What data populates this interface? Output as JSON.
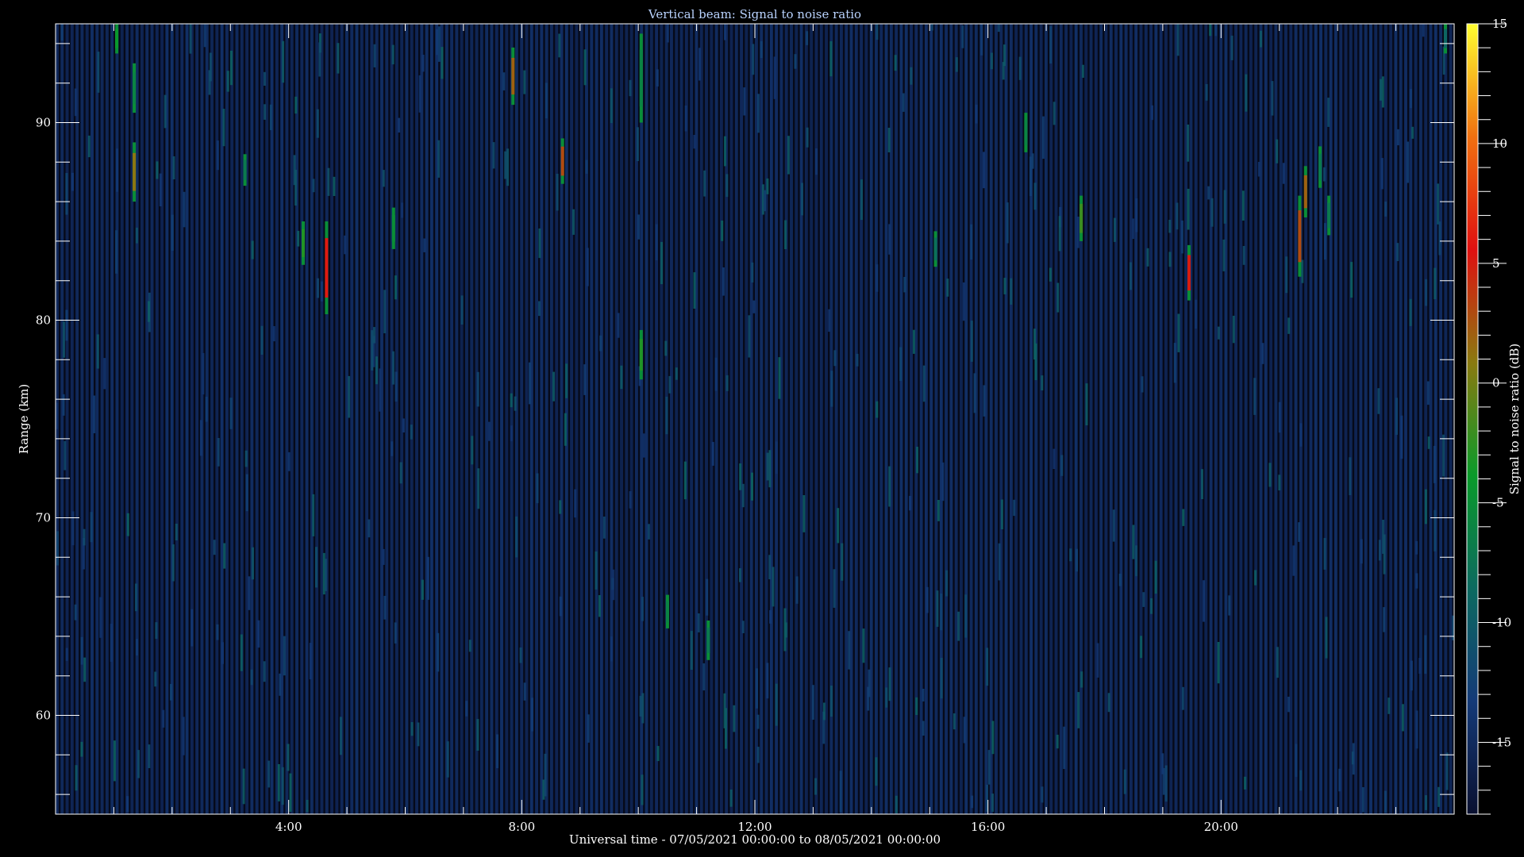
{
  "chart_data": {
    "type": "heatmap",
    "title": "Vertical beam: Signal to noise ratio",
    "xlabel": "Universal time - 07/05/2021 00:00:00 to 08/05/2021 00:00:00",
    "ylabel": "Range (km)",
    "colorbar_label": "Signal to noise ratio (dB)",
    "xlim_hours": [
      0,
      24
    ],
    "ylim_km": [
      55,
      95
    ],
    "zlim_db": [
      -18,
      15
    ],
    "x_ticks": [
      {
        "value": 4,
        "label": "4:00"
      },
      {
        "value": 8,
        "label": "8:00"
      },
      {
        "value": 12,
        "label": "12:00"
      },
      {
        "value": 16,
        "label": "16:00"
      },
      {
        "value": 20,
        "label": "20:00"
      }
    ],
    "y_ticks": [
      {
        "value": 60,
        "label": "60"
      },
      {
        "value": 70,
        "label": "70"
      },
      {
        "value": 80,
        "label": "80"
      },
      {
        "value": 90,
        "label": "90"
      }
    ],
    "colorbar_ticks": [
      {
        "value": 15,
        "label": "15"
      },
      {
        "value": 10,
        "label": "10"
      },
      {
        "value": 5,
        "label": "5"
      },
      {
        "value": 0,
        "label": "0"
      },
      {
        "value": -5,
        "label": "-5"
      },
      {
        "value": -10,
        "label": "-10"
      },
      {
        "value": -15,
        "label": "-15"
      }
    ],
    "colormap": [
      "#0a1030",
      "#143a78",
      "#0c6a60",
      "#0a9a2a",
      "#8a7a10",
      "#e01010",
      "#f07010",
      "#ffff30"
    ],
    "background_db": -16,
    "echoes": [
      {
        "t": 1.05,
        "r0": 93.5,
        "r1": 95.0,
        "db": -4
      },
      {
        "t": 1.35,
        "r0": 90.5,
        "r1": 93.0,
        "db": -6
      },
      {
        "t": 1.35,
        "r0": 86.0,
        "r1": 89.0,
        "db": 1
      },
      {
        "t": 3.25,
        "r0": 86.8,
        "r1": 88.4,
        "db": -7
      },
      {
        "t": 4.25,
        "r0": 82.8,
        "r1": 85.0,
        "db": -3
      },
      {
        "t": 4.65,
        "r0": 80.3,
        "r1": 85.0,
        "db": 6
      },
      {
        "t": 5.8,
        "r0": 83.6,
        "r1": 85.7,
        "db": -5
      },
      {
        "t": 7.85,
        "r0": 90.9,
        "r1": 93.8,
        "db": 2
      },
      {
        "t": 8.7,
        "r0": 86.9,
        "r1": 89.2,
        "db": 3
      },
      {
        "t": 10.05,
        "r0": 90.0,
        "r1": 94.5,
        "db": -6
      },
      {
        "t": 10.05,
        "r0": 77.0,
        "r1": 79.5,
        "db": -3
      },
      {
        "t": 10.5,
        "r0": 64.4,
        "r1": 66.1,
        "db": -6
      },
      {
        "t": 11.2,
        "r0": 62.8,
        "r1": 64.8,
        "db": -7
      },
      {
        "t": 15.1,
        "r0": 82.7,
        "r1": 84.5,
        "db": -8
      },
      {
        "t": 16.65,
        "r0": 88.5,
        "r1": 90.5,
        "db": -6
      },
      {
        "t": 17.6,
        "r0": 84.0,
        "r1": 86.3,
        "db": -2
      },
      {
        "t": 19.45,
        "r0": 81.0,
        "r1": 83.8,
        "db": 5
      },
      {
        "t": 21.35,
        "r0": 82.2,
        "r1": 86.3,
        "db": 3
      },
      {
        "t": 21.45,
        "r0": 85.2,
        "r1": 87.8,
        "db": 2
      },
      {
        "t": 21.7,
        "r0": 86.7,
        "r1": 88.8,
        "db": -7
      },
      {
        "t": 21.85,
        "r0": 84.3,
        "r1": 86.3,
        "db": -7
      },
      {
        "t": 23.85,
        "r0": 93.5,
        "r1": 95.0,
        "db": -9
      }
    ]
  }
}
